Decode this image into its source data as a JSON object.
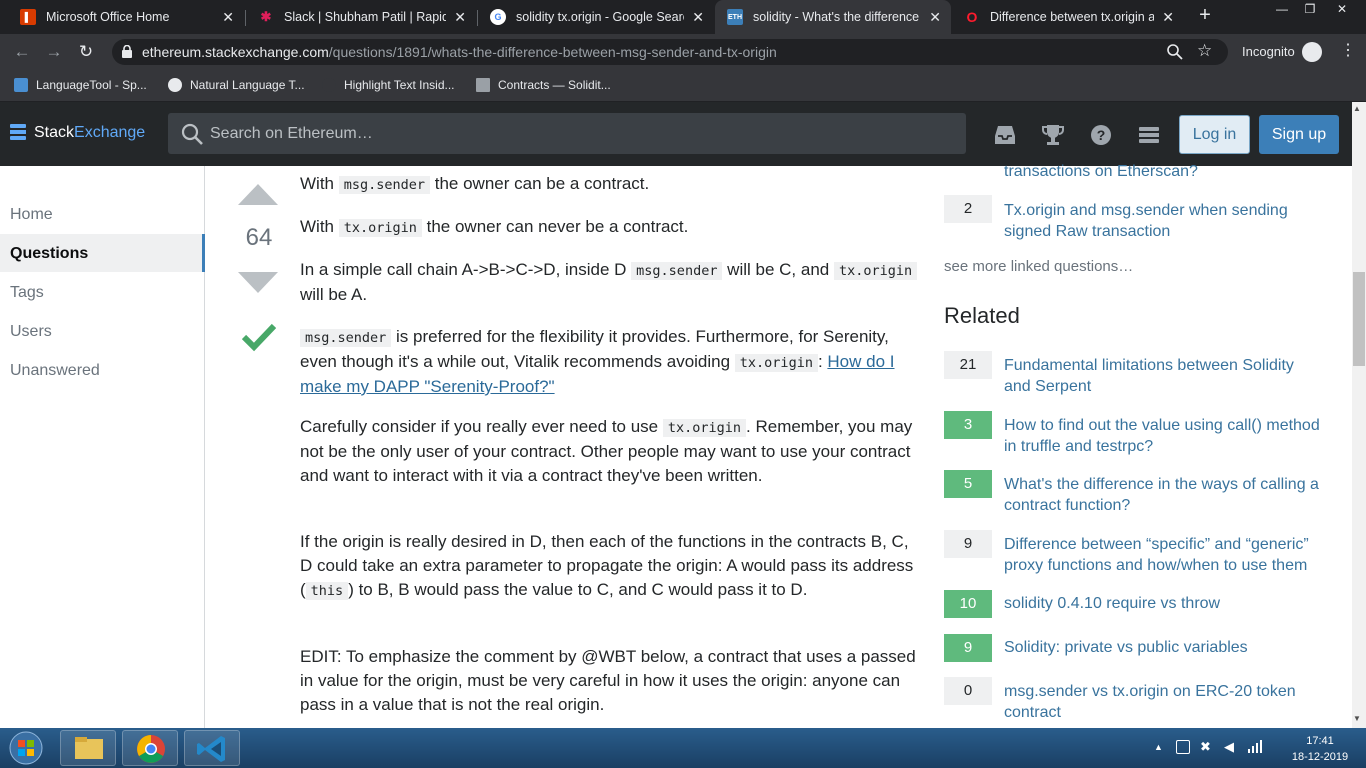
{
  "browser": {
    "tabs": [
      {
        "title": "Microsoft Office Home",
        "favicon": "office-icon"
      },
      {
        "title": "Slack | Shubham Patil | Rapidqube",
        "favicon": "slack-icon"
      },
      {
        "title": "solidity tx.origin - Google Search",
        "favicon": "google-icon"
      },
      {
        "title": "solidity - What's the difference between",
        "favicon": "ethereum-icon",
        "active": true
      },
      {
        "title": "Difference between tx.origin and",
        "favicon": "opera-icon"
      }
    ],
    "url_host": "ethereum.stackexchange.com",
    "url_path": "/questions/1891/whats-the-difference-between-msg-sender-and-tx-origin",
    "incognito_label": "Incognito",
    "bookmarks": [
      "LanguageTool - Sp...",
      "Natural Language T...",
      "Highlight Text Insid...",
      "Contracts — Solidit..."
    ]
  },
  "site": {
    "logo_stack": "Stack",
    "logo_exchange": "Exchange",
    "search_placeholder": "Search on Ethereum…",
    "login": "Log in",
    "signup": "Sign up"
  },
  "leftnav": [
    "Home",
    "Questions",
    "Tags",
    "Users",
    "Unanswered"
  ],
  "answer": {
    "votes": "64",
    "p1": {
      "a": "With ",
      "code": "msg.sender",
      "b": " the owner can be a contract."
    },
    "p2": {
      "a": "With ",
      "code": "tx.origin",
      "b": " the owner can never be a contract."
    },
    "p3": {
      "a": "In a simple call chain A->B->C->D, inside D ",
      "code1": "msg.sender",
      "b": " will be C, and ",
      "code2": "tx.origin",
      "c": " will be A."
    },
    "p4": {
      "code1": "msg.sender",
      "a": " is preferred for the flexibility it provides. Furthermore, for Serenity, even though it's a while out, Vitalik recommends avoiding ",
      "code2": "tx.origin",
      "b": ": ",
      "link": "How do I make my DAPP \"Serenity-Proof?\""
    },
    "p5": {
      "a": "Carefully consider if you really ever need to use ",
      "code": "tx.origin",
      "b": ". Remember, you may not be the only user of your contract. Other people may want to use your contract and want to interact with it via a contract they've been written."
    },
    "p6": {
      "a": "If the origin is really desired in D, then each of the functions in the contracts B, C, D could take an extra parameter to propagate the origin: A would pass its address (",
      "code": "this",
      "b": ") to B, B would pass the value to C, and C would pass it to D."
    },
    "p7": "EDIT: To emphasize the comment by @WBT below, a contract that uses a passed in value for the origin, must be very careful in how it uses the origin: anyone can pass in a value that is not the real origin."
  },
  "sidebar": {
    "linked_tail": "transactions on Etherscan?",
    "linked": [
      {
        "count": "2",
        "title": "Tx.origin and msg.sender when sending signed Raw transaction"
      }
    ],
    "see_more": "see more linked questions…",
    "related_title": "Related",
    "related": [
      {
        "count": "21",
        "accepted": false,
        "title": "Fundamental limitations between Solidity and Serpent"
      },
      {
        "count": "3",
        "accepted": true,
        "title": "How to find out the value using call() method in truffle and testrpc?"
      },
      {
        "count": "5",
        "accepted": true,
        "title": "What's the difference in the ways of calling a contract function?"
      },
      {
        "count": "9",
        "accepted": false,
        "title": "Difference between “specific” and “generic” proxy functions and how/when to use them"
      },
      {
        "count": "10",
        "accepted": true,
        "title": "solidity 0.4.10 require vs throw"
      },
      {
        "count": "9",
        "accepted": true,
        "title": "Solidity: private vs public variables"
      },
      {
        "count": "0",
        "accepted": false,
        "title": "msg.sender vs tx.origin on ERC-20 token contract"
      }
    ]
  },
  "taskbar": {
    "time": "17:41",
    "date": "18-12-2019"
  },
  "colors": {
    "accepted": "#5fba7d",
    "link": "#39739d",
    "header": "#242729",
    "accent": "#3c7fb8"
  }
}
